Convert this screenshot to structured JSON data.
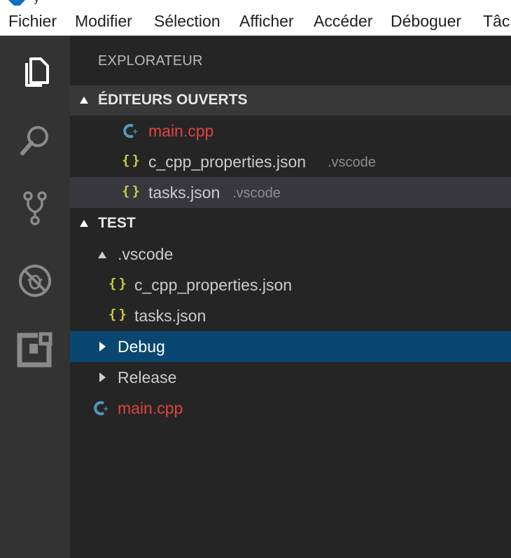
{
  "window": {
    "title_fragment": "y"
  },
  "menu": {
    "items": [
      "Fichier",
      "Modifier",
      "Sélection",
      "Afficher",
      "Accéder",
      "Déboguer",
      "Tâch"
    ]
  },
  "activity_bar": {
    "icons": [
      "explorer-icon",
      "search-icon",
      "source-control-icon",
      "debug-icon",
      "extensions-icon"
    ]
  },
  "explorer": {
    "title": "EXPLORATEUR",
    "open_editors": {
      "header": "ÉDITEURS OUVERTS",
      "items": [
        {
          "name": "main.cpp",
          "folder": "",
          "icon": "cpp-icon",
          "color": "#e0443e"
        },
        {
          "name": "c_cpp_properties.json",
          "folder": ".vscode",
          "icon": "json-icon"
        },
        {
          "name": "tasks.json",
          "folder": ".vscode",
          "icon": "json-icon",
          "hovered": true
        }
      ]
    },
    "workspace": {
      "header": "TEST",
      "tree": [
        {
          "name": ".vscode",
          "type": "folder",
          "expanded": true
        },
        {
          "name": "c_cpp_properties.json",
          "type": "file",
          "icon": "json-icon"
        },
        {
          "name": "tasks.json",
          "type": "file",
          "icon": "json-icon"
        },
        {
          "name": "Debug",
          "type": "folder",
          "expanded": false,
          "selected": true
        },
        {
          "name": "Release",
          "type": "folder",
          "expanded": false
        },
        {
          "name": "main.cpp",
          "type": "file",
          "icon": "cpp-icon",
          "color": "#e0443e"
        }
      ]
    }
  },
  "colors": {
    "accent_selected": "#094771",
    "cpp_file": "#e0443e",
    "json_icon": "#cbcb41",
    "cpp_icon": "#519aba"
  }
}
